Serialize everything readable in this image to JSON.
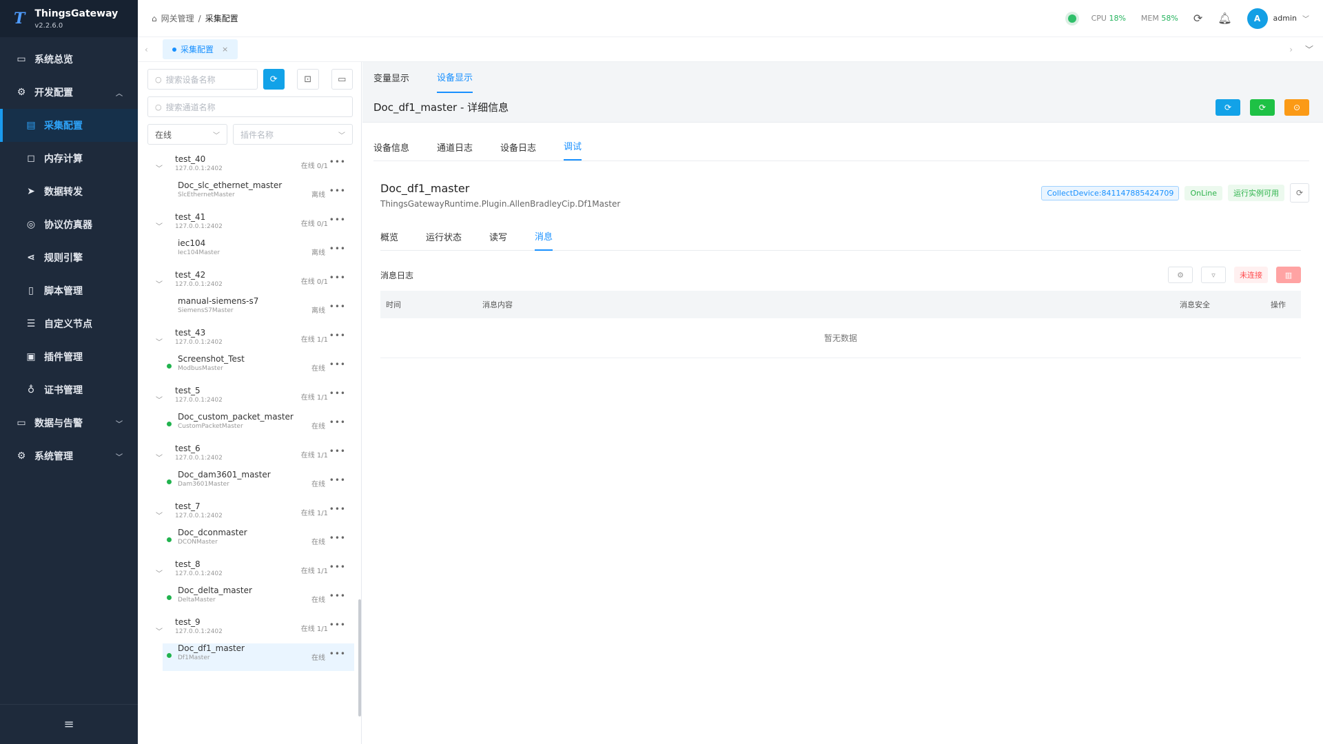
{
  "app": {
    "name": "ThingsGateway",
    "version": "v2.2.6.0"
  },
  "sidebar": {
    "items": [
      {
        "label": "系统总览",
        "icon": "monitor-icon"
      },
      {
        "label": "开发配置",
        "icon": "gear-icon"
      },
      {
        "label": "采集配置",
        "icon": "collect-icon"
      },
      {
        "label": "内存计算",
        "icon": "chip-icon"
      },
      {
        "label": "数据转发",
        "icon": "send-icon"
      },
      {
        "label": "协议仿真器",
        "icon": "simulator-icon"
      },
      {
        "label": "规则引擎",
        "icon": "share-icon"
      },
      {
        "label": "脚本管理",
        "icon": "script-icon"
      },
      {
        "label": "自定义节点",
        "icon": "sliders-icon"
      },
      {
        "label": "插件管理",
        "icon": "plugin-icon"
      },
      {
        "label": "证书管理",
        "icon": "certificate-icon"
      },
      {
        "label": "数据与告警",
        "icon": "alarm-icon"
      },
      {
        "label": "系统管理",
        "icon": "settings-icon"
      }
    ]
  },
  "header": {
    "breadcrumb": [
      "网关管理",
      "采集配置"
    ],
    "cpu_label": "CPU",
    "cpu_value": "18%",
    "mem_label": "MEM",
    "mem_value": "58%",
    "user": "admin",
    "avatar_letter": "A"
  },
  "page_tab": {
    "label": "采集配置"
  },
  "devpanel": {
    "device_search_placeholder": "搜索设备名称",
    "channel_search_placeholder": "搜索通道名称",
    "status_select": "在线",
    "plugin_select_placeholder": "插件名称",
    "groups": [
      {
        "name": "test_40",
        "addr": "127.0.0.1:2402",
        "status": "在线 0/1",
        "device": {
          "name": "Doc_slc_ethernet_master",
          "plugin": "SlcEthernetMaster",
          "status": "离线",
          "online": false
        }
      },
      {
        "name": "test_41",
        "addr": "127.0.0.1:2402",
        "status": "在线 0/1",
        "device": {
          "name": "iec104",
          "plugin": "Iec104Master",
          "status": "离线",
          "online": false
        }
      },
      {
        "name": "test_42",
        "addr": "127.0.0.1:2402",
        "status": "在线 0/1",
        "device": {
          "name": "manual-siemens-s7",
          "plugin": "SiemensS7Master",
          "status": "离线",
          "online": false
        }
      },
      {
        "name": "test_43",
        "addr": "127.0.0.1:2402",
        "status": "在线 1/1",
        "device": {
          "name": "Screenshot_Test",
          "plugin": "ModbusMaster",
          "status": "在线",
          "online": true
        }
      },
      {
        "name": "test_5",
        "addr": "127.0.0.1:2402",
        "status": "在线 1/1",
        "device": {
          "name": "Doc_custom_packet_master",
          "plugin": "CustomPacketMaster",
          "status": "在线",
          "online": true
        }
      },
      {
        "name": "test_6",
        "addr": "127.0.0.1:2402",
        "status": "在线 1/1",
        "device": {
          "name": "Doc_dam3601_master",
          "plugin": "Dam3601Master",
          "status": "在线",
          "online": true
        }
      },
      {
        "name": "test_7",
        "addr": "127.0.0.1:2402",
        "status": "在线 1/1",
        "device": {
          "name": "Doc_dconmaster",
          "plugin": "DCONMaster",
          "status": "在线",
          "online": true
        }
      },
      {
        "name": "test_8",
        "addr": "127.0.0.1:2402",
        "status": "在线 1/1",
        "device": {
          "name": "Doc_delta_master",
          "plugin": "DeltaMaster",
          "status": "在线",
          "online": true
        }
      },
      {
        "name": "test_9",
        "addr": "127.0.0.1:2402",
        "status": "在线 1/1",
        "device": {
          "name": "Doc_df1_master",
          "plugin": "Df1Master",
          "status": "在线",
          "online": true
        }
      }
    ]
  },
  "main": {
    "top_tabs": [
      "变量显示",
      "设备显示"
    ],
    "detail_title": "Doc_df1_master - 详细信息",
    "section_tabs": [
      "设备信息",
      "通道日志",
      "设备日志",
      "调试"
    ],
    "device_name": "Doc_df1_master",
    "device_plugin": "ThingsGatewayRuntime.Plugin.AllenBradleyCip.Df1Master",
    "tags": [
      "CollectDevice:841147885424709",
      "OnLine",
      "运行实例可用"
    ],
    "inner_tabs": [
      "概览",
      "运行状态",
      "读写",
      "消息"
    ],
    "log_title": "消息日志",
    "disconnected_label": "未连接",
    "table_headers": [
      "时间",
      "消息内容",
      "消息安全",
      "操作"
    ],
    "empty_text": "暂无数据"
  }
}
